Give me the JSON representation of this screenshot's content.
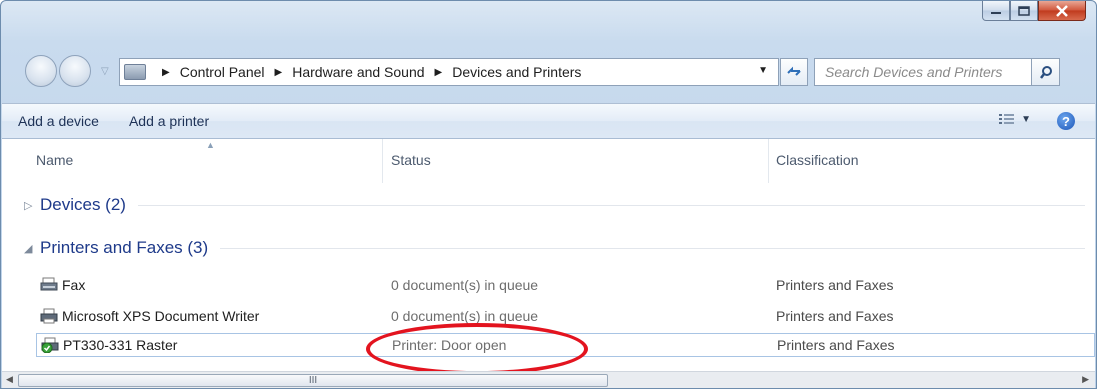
{
  "window": {
    "caption_buttons": [
      "minimize",
      "maximize",
      "close"
    ]
  },
  "address_bar": {
    "breadcrumbs": [
      "Control Panel",
      "Hardware and Sound",
      "Devices and Printers"
    ],
    "search_placeholder": "Search Devices and Printers"
  },
  "command_bar": {
    "add_device": "Add a device",
    "add_printer": "Add a printer",
    "view_icon": "view-options-icon",
    "help_label": "?"
  },
  "columns": {
    "name": "Name",
    "status": "Status",
    "classification": "Classification"
  },
  "groups": [
    {
      "label": "Devices (2)",
      "expanded": false
    },
    {
      "label": "Printers and Faxes (3)",
      "expanded": true
    }
  ],
  "rows": [
    {
      "name": "Fax",
      "status": "0 document(s) in queue",
      "classification": "Printers and Faxes",
      "icon": "fax-icon"
    },
    {
      "name": "Microsoft XPS Document Writer",
      "status": "0 document(s) in queue",
      "classification": "Printers and Faxes",
      "icon": "printer-icon"
    },
    {
      "name": "PT330-331 Raster",
      "status": "Printer:  Door open",
      "classification": "Printers and Faxes",
      "icon": "default-printer-icon"
    }
  ],
  "scrollbar": {
    "thumb_grip": "III"
  },
  "annotation_color": "#e3141f"
}
